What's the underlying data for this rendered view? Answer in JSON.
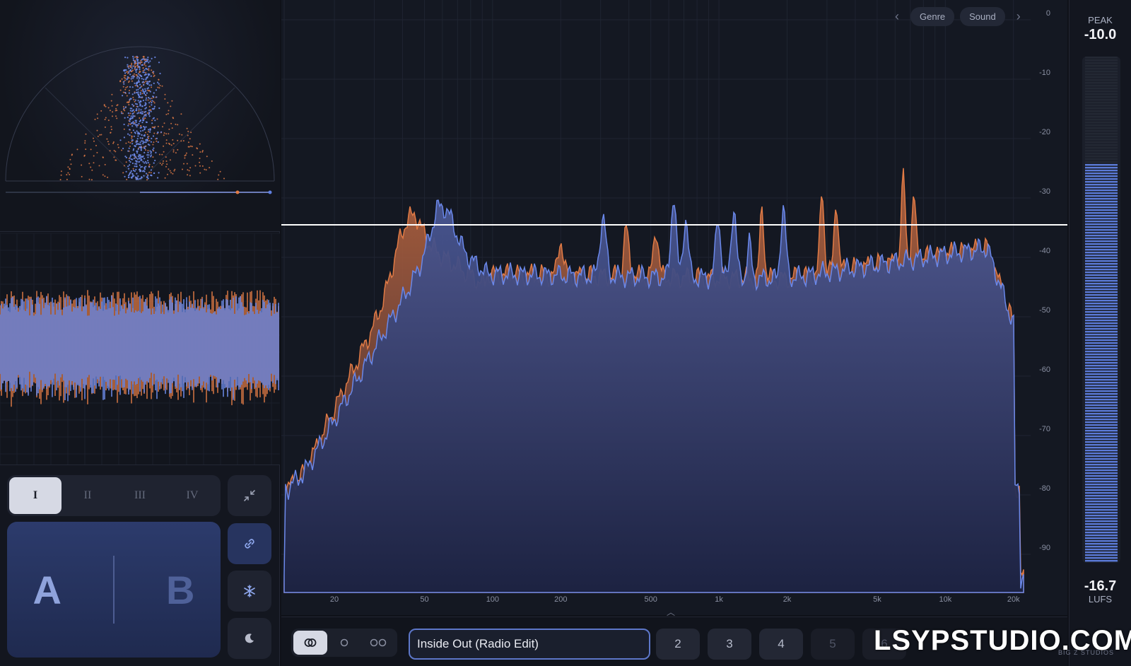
{
  "spectrum": {
    "nav": {
      "genre_label": "Genre",
      "sound_label": "Sound"
    },
    "y_ticks": [
      "0",
      "-10",
      "-20",
      "-30",
      "-40",
      "-50",
      "-60",
      "-70",
      "-80",
      "-90"
    ],
    "x_ticks": [
      "20",
      "50",
      "100",
      "200",
      "500",
      "1k",
      "2k",
      "5k",
      "10k",
      "20k"
    ],
    "colors": {
      "reference": "#e07a45",
      "input": "#5f7fe0",
      "threshold": "#ffffff"
    }
  },
  "reference_tabs": [
    {
      "label": "I",
      "active": true
    },
    {
      "label": "II",
      "active": false
    },
    {
      "label": "III",
      "active": false
    },
    {
      "label": "IV",
      "active": false
    }
  ],
  "ab": {
    "a_label": "A",
    "b_label": "B"
  },
  "side_buttons": [
    "collapse-icon",
    "link-icon",
    "snowflake-icon",
    "moon-icon"
  ],
  "bottom_bar": {
    "track_name": "Inside Out (Radio Edit)",
    "slots": [
      "2",
      "3",
      "4",
      "5",
      "6"
    ]
  },
  "meter": {
    "peak_label": "PEAK",
    "peak_value": "-10.0",
    "lufs_value": "-16.7",
    "lufs_label": "LUFS",
    "level": 0.79
  },
  "watermark": {
    "text": "LSYPSTUDIO.COM",
    "brand_sub": "BIG Z STUDIOS"
  }
}
